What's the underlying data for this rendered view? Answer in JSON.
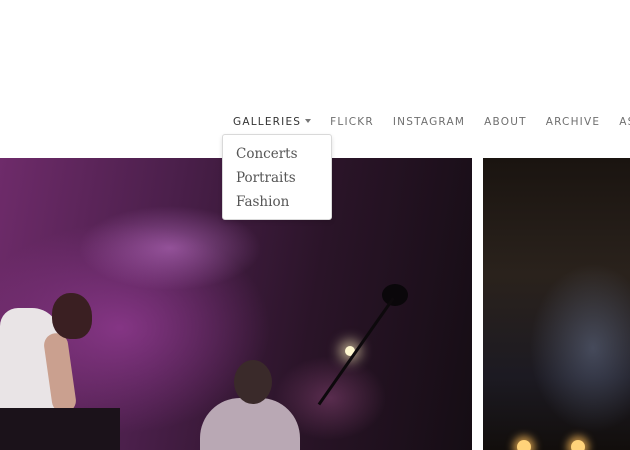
{
  "nav": {
    "items": [
      {
        "label": "GALLERIES",
        "has_caret": true
      },
      {
        "label": "FLICKR"
      },
      {
        "label": "INSTAGRAM"
      },
      {
        "label": "ABOUT"
      },
      {
        "label": "ARCHIVE"
      },
      {
        "label": "ASK"
      }
    ],
    "text_color": "#6f6f6f"
  },
  "galleries_dropdown": {
    "open": true,
    "items": [
      "Concerts",
      "Portraits",
      "Fashion"
    ]
  },
  "photos": [
    {
      "subject": "concert-stage-purple-lights"
    },
    {
      "subject": "concert-stage-dark"
    }
  ],
  "icons": {
    "caret": "caret-down-icon"
  }
}
